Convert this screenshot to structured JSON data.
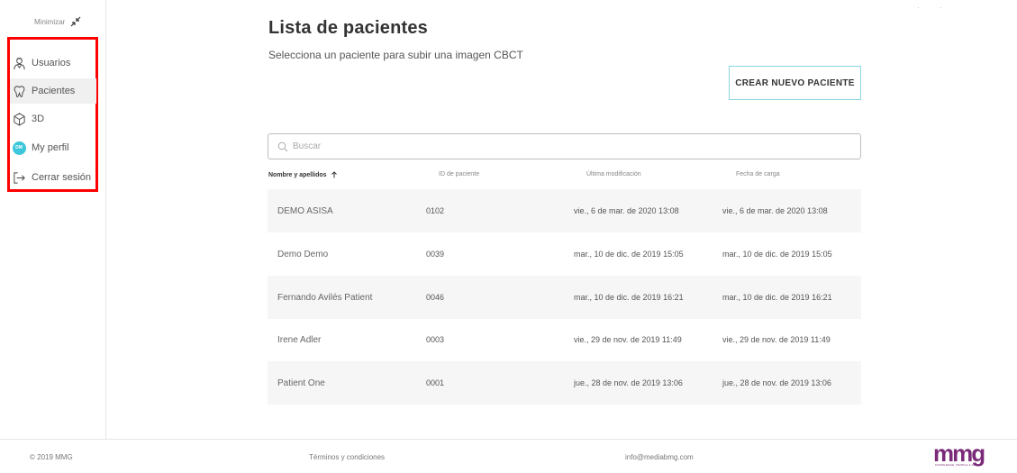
{
  "sidebar": {
    "minimize_label": "Minimizar",
    "items": [
      {
        "label": "Usuarios",
        "icon": "doctor-icon"
      },
      {
        "label": "Pacientes",
        "icon": "tooth-icon"
      },
      {
        "label": "3D",
        "icon": "cube-icon"
      },
      {
        "label": "My perfil",
        "icon": "avatar-icon",
        "avatar_initials": "DM"
      },
      {
        "label": "Cerrar sesión",
        "icon": "logout-icon"
      }
    ],
    "active_index": 1,
    "highlight_color": "#ff0000"
  },
  "main": {
    "title": "Lista de pacientes",
    "subtitle": "Selecciona un paciente para subir una imagen CBCT",
    "create_button_label": "CREAR NUEVO PACIENTE",
    "search_placeholder": "Buscar",
    "table": {
      "headers": [
        "Nombre y apellidos",
        "ID de paciente",
        "Última modificación",
        "Fecha de carga"
      ],
      "sort_column": "Nombre y apellidos",
      "sort_direction": "asc",
      "rows": [
        {
          "name": "DEMO ASISA",
          "id": "0102",
          "modified": "vie., 6 de mar. de 2020 13:08",
          "loaded": "vie., 6 de mar. de 2020 13:08"
        },
        {
          "name": "Demo Demo",
          "id": "0039",
          "modified": "mar., 10 de dic. de 2019 15:05",
          "loaded": "mar., 10 de dic. de 2019 15:05"
        },
        {
          "name": "Fernando Avilés Patient",
          "id": "0046",
          "modified": "mar., 10 de dic. de 2019 16:21",
          "loaded": "mar., 10 de dic. de 2019 16:21"
        },
        {
          "name": "Irene Adler",
          "id": "0003",
          "modified": "vie., 29 de nov. de 2019 11:49",
          "loaded": "vie., 29 de nov. de 2019 11:49"
        },
        {
          "name": "Patient One",
          "id": "0001",
          "modified": "jue., 28 de nov. de 2019 13:06",
          "loaded": "jue., 28 de nov. de 2019 13:06"
        }
      ]
    }
  },
  "footer": {
    "copyright": "© 2019 MMG",
    "terms": "Términos y condiciones",
    "email": "info@mediabmg.com",
    "logo_text": "mmg",
    "logo_tagline": "KNOWLEDGE, PEOPLE & AI",
    "logo_color": "#7a2a78"
  },
  "colors": {
    "accent": "#3cc6d9",
    "button_border": "#8ad6e0"
  }
}
